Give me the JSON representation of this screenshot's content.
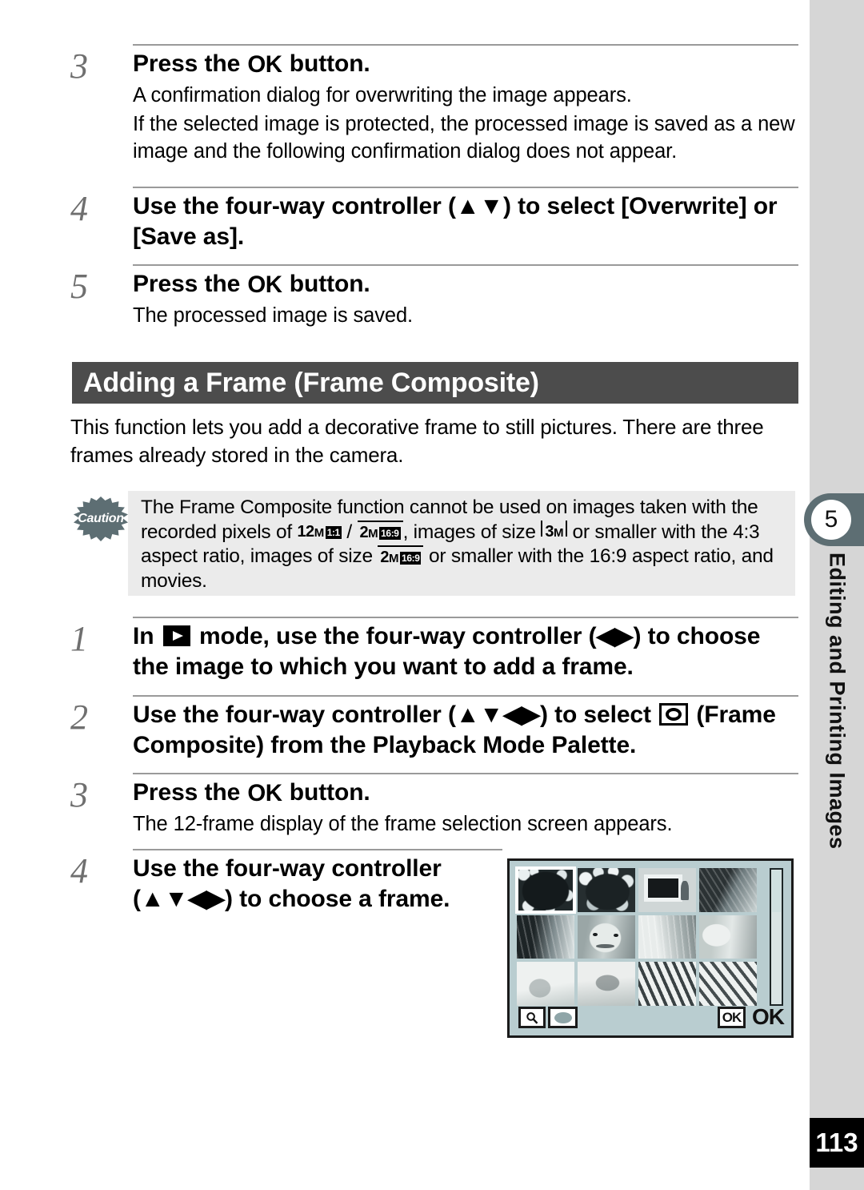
{
  "page": {
    "number": "113",
    "chapter_badge": "5",
    "chapter_label": "Editing and Printing Images"
  },
  "steps_top": [
    {
      "num": "3",
      "heading_pre": "Press the ",
      "heading_ok": "OK",
      "heading_post": " button.",
      "paragraphs": [
        "A confirmation dialog for overwriting the image appears.",
        "If the selected image is protected, the processed image is saved as a new image and the following confirmation dialog does not appear."
      ]
    },
    {
      "num": "4",
      "heading": "Use the four-way controller (▲▼) to select [Overwrite] or [Save as].",
      "paragraphs": []
    },
    {
      "num": "5",
      "heading_pre": "Press the ",
      "heading_ok": "OK",
      "heading_post": " button.",
      "paragraphs": [
        "The processed image is saved."
      ]
    }
  ],
  "section": {
    "title": "Adding a Frame (Frame Composite)",
    "intro": "This function lets you add a decorative frame to still pictures. There are three frames already stored in the camera."
  },
  "caution": {
    "icon_label": "Caution",
    "text_1": "The Frame Composite function cannot be used on images taken with the recorded pixels of ",
    "size_12m": "12",
    "size_12m_unit": "M",
    "size_12m_ratio": "1:1",
    "separator": " / ",
    "size_2m": "2",
    "size_2m_unit": "M",
    "size_2m_ratio": "16:9",
    "text_2": ", images of size ",
    "size_3m": "3",
    "size_3m_unit": "M",
    "text_3": " or smaller with the 4:3 aspect ratio, images of size ",
    "size_2m_b": "2",
    "size_2m_b_unit": "M",
    "size_2m_b_ratio": "16:9",
    "text_4": " or smaller with the 16:9 aspect ratio, and movies."
  },
  "steps_bottom": [
    {
      "num": "1",
      "heading_a": "In ",
      "heading_b": " mode, use the four-way controller (◀▶) to choose the image to which you want to add a frame.",
      "icon": "playback-mode-icon"
    },
    {
      "num": "2",
      "heading_a": "Use the four-way controller (▲▼◀▶) to select ",
      "heading_b": " (Frame Composite) from the Playback Mode Palette.",
      "icon": "frame-composite-icon"
    },
    {
      "num": "3",
      "heading_pre": "Press the ",
      "heading_ok": "OK",
      "heading_post": " button.",
      "paragraphs": [
        "The 12-frame display of the frame selection screen appears."
      ]
    },
    {
      "num": "4",
      "heading": "Use the four-way controller (▲▼◀▶) to choose a frame.",
      "paragraphs": []
    }
  ],
  "lcd": {
    "selected_index": 0,
    "thumbnails": [
      {
        "name": "frame-heart-daisies",
        "style": "t-frame-heart"
      },
      {
        "name": "frame-flower-wreath",
        "style": "t-frame-flower"
      },
      {
        "name": "frame-photo-border",
        "style": "t-frame-photo"
      },
      {
        "name": "photo-hair-dark",
        "style": "t-hair-dark"
      },
      {
        "name": "photo-hair-left",
        "style": "t-hair-left"
      },
      {
        "name": "photo-girl-face",
        "style": "t-face"
      },
      {
        "name": "photo-blonde-hair",
        "style": "t-blonde"
      },
      {
        "name": "photo-girl-right",
        "style": "t-girl-right"
      },
      {
        "name": "photo-pale-bottom",
        "style": "t-pale"
      },
      {
        "name": "photo-fabric",
        "style": "t-fabric"
      },
      {
        "name": "photo-stripes",
        "style": "t-stripes"
      },
      {
        "name": "photo-stripes-right",
        "style": "t-stripes2"
      }
    ],
    "buttons": {
      "zoom_icon": "magnifier-icon",
      "oval_icon": "oval-icon",
      "ok_small": "OK",
      "ok_label": "OK"
    }
  }
}
